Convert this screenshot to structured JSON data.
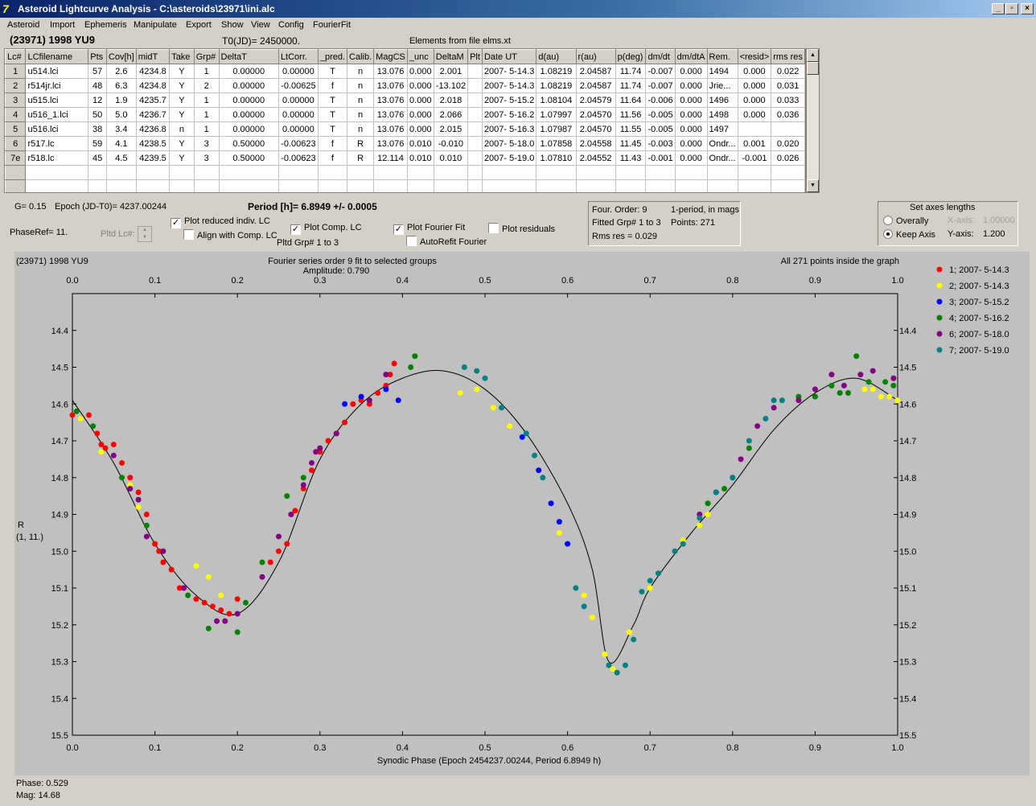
{
  "window": {
    "title": "Asteroid Lightcurve Analysis - C:\\asteroids\\23971\\ini.alc"
  },
  "menu": [
    "Asteroid",
    "Import",
    "Ephemeris",
    "Manipulate",
    "Export",
    "Show",
    "View",
    "Config",
    "FourierFit"
  ],
  "header": {
    "asteroid": "(23971) 1998 YU9",
    "t0": "T0(JD)= 2450000.",
    "elements": "Elements from file elms.xt"
  },
  "table": {
    "columns": [
      "Lc#",
      "LCfilename",
      "Pts",
      "Cov[h]",
      "midT",
      "Take",
      "Grp#",
      "DeltaT",
      "LtCorr.",
      "_pred.",
      "Calib.",
      "MagCS",
      "_unc",
      "DeltaM",
      "Plt",
      "Date UT",
      "d(au)",
      "r(au)",
      "p(deg)",
      "dm/dt",
      "dm/dtA",
      "Rem.",
      "<resid>",
      "rms res"
    ],
    "rows": [
      [
        "1",
        "u514.lci",
        "57",
        "2.6",
        "4234.8",
        "Y",
        "1",
        "0.00000",
        "0.00000",
        "T",
        "n",
        "13.076",
        "0.000",
        "2.001",
        "",
        "2007- 5-14.3",
        "1.08219",
        "2.04587",
        "11.74",
        "-0.007",
        "0.000",
        "1494",
        "0.000",
        "0.022"
      ],
      [
        "2",
        "r514jr.lci",
        "48",
        "6.3",
        "4234.8",
        "Y",
        "2",
        "0.00000",
        "-0.00625",
        "f",
        "n",
        "13.076",
        "0.000",
        "-13.102",
        "",
        "2007- 5-14.3",
        "1.08219",
        "2.04587",
        "11.74",
        "-0.007",
        "0.000",
        "Jrie...",
        "0.000",
        "0.031"
      ],
      [
        "3",
        "u515.lci",
        "12",
        "1.9",
        "4235.7",
        "Y",
        "1",
        "0.00000",
        "0.00000",
        "T",
        "n",
        "13.076",
        "0.000",
        "2.018",
        "",
        "2007- 5-15.2",
        "1.08104",
        "2.04579",
        "11.64",
        "-0.006",
        "0.000",
        "1496",
        "0.000",
        "0.033"
      ],
      [
        "4",
        "u516_1.lci",
        "50",
        "5.0",
        "4236.7",
        "Y",
        "1",
        "0.00000",
        "0.00000",
        "T",
        "n",
        "13.076",
        "0.000",
        "2.066",
        "",
        "2007- 5-16.2",
        "1.07997",
        "2.04570",
        "11.56",
        "-0.005",
        "0.000",
        "1498",
        "0.000",
        "0.036"
      ],
      [
        "5",
        "u516.lci",
        "38",
        "3.4",
        "4236.8",
        "n",
        "1",
        "0.00000",
        "0.00000",
        "T",
        "n",
        "13.076",
        "0.000",
        "2.015",
        "",
        "2007- 5-16.3",
        "1.07987",
        "2.04570",
        "11.55",
        "-0.005",
        "0.000",
        "1497",
        "",
        ""
      ],
      [
        "6",
        "r517.lc",
        "59",
        "4.1",
        "4238.5",
        "Y",
        "3",
        "0.50000",
        "-0.00623",
        "f",
        "R",
        "13.076",
        "0.010",
        "-0.010",
        "",
        "2007- 5-18.0",
        "1.07858",
        "2.04558",
        "11.45",
        "-0.003",
        "0.000",
        "Ondr...",
        "0.001",
        "0.020"
      ],
      [
        "7e",
        "r518.lc",
        "45",
        "4.5",
        "4239.5",
        "Y",
        "3",
        "0.50000",
        "-0.00623",
        "f",
        "R",
        "12.114",
        "0.010",
        "0.010",
        "",
        "2007- 5-19.0",
        "1.07810",
        "2.04552",
        "11.43",
        "-0.001",
        "0.000",
        "Ondr...",
        "-0.001",
        "0.026"
      ]
    ]
  },
  "info": {
    "g": "G= 0.15",
    "epoch": "Epoch (JD-T0)= 4237.00244",
    "period": "Period [h]= 6.8949 +/- 0.0005",
    "phaseref": "PhaseRef= 11.",
    "pltd_lc": "Pltd Lc#:",
    "pltd_grp": "Pltd Grp#  1   to   3"
  },
  "checks": {
    "plot_reduced": "Plot reduced indiv. LC",
    "align_comp": "Align with Comp. LC",
    "plot_comp": "Plot Comp. LC",
    "plot_fourier": "Plot Fourier Fit",
    "autorefit": "AutoRefit Fourier",
    "plot_resid": "Plot residuals"
  },
  "fourier": {
    "order": "Four. Order:  9",
    "period_mode": "1-period, in mags",
    "fitted": "Fitted Grp# 1 to 3",
    "points": "Points: 271",
    "rms": "Rms res     = 0.029"
  },
  "axes": {
    "title": "Set axes lengths",
    "overally": "Overally",
    "keep": "Keep Axis",
    "xlabel": "X-axis:",
    "xval": "1.00000",
    "ylabel": "Y-axis:",
    "yval": "1.200"
  },
  "status": {
    "phase": "Phase:  0.529",
    "mag": "Mag:    14.68"
  },
  "chart_data": {
    "type": "scatter",
    "title_left": "(23971) 1998 YU9",
    "title_center": "Fourier series order 9 fit to selected groups",
    "amplitude": "Amplitude: 0.790",
    "title_right": "All 271 points inside the graph",
    "xlabel": "Synodic Phase (Epoch 2454237.00244, Period 6.8949 h)",
    "ylabel": [
      "R",
      "(1, 11.)"
    ],
    "xlim": [
      0.0,
      1.0
    ],
    "ylim": [
      14.3,
      15.5
    ],
    "y_reversed": true,
    "xticks": [
      "0.0",
      "0.1",
      "0.2",
      "0.3",
      "0.4",
      "0.5",
      "0.6",
      "0.7",
      "0.8",
      "0.9",
      "1.0"
    ],
    "yticks": [
      "14.4",
      "14.5",
      "14.6",
      "14.7",
      "14.8",
      "14.9",
      "15.0",
      "15.1",
      "15.2",
      "15.3",
      "15.4",
      "15.5"
    ],
    "background": "#c0c0c0",
    "legend_position": "right",
    "fit_curve": [
      [
        0,
        14.59
      ],
      [
        0.05,
        14.76
      ],
      [
        0.1,
        14.98
      ],
      [
        0.15,
        15.12
      ],
      [
        0.2,
        15.17
      ],
      [
        0.25,
        15.03
      ],
      [
        0.3,
        14.75
      ],
      [
        0.35,
        14.6
      ],
      [
        0.4,
        14.53
      ],
      [
        0.45,
        14.51
      ],
      [
        0.5,
        14.56
      ],
      [
        0.55,
        14.68
      ],
      [
        0.6,
        14.87
      ],
      [
        0.63,
        15.05
      ],
      [
        0.65,
        15.3
      ],
      [
        0.68,
        15.2
      ],
      [
        0.7,
        15.1
      ],
      [
        0.75,
        14.95
      ],
      [
        0.8,
        14.82
      ],
      [
        0.85,
        14.67
      ],
      [
        0.9,
        14.57
      ],
      [
        0.95,
        14.53
      ],
      [
        1.0,
        14.59
      ]
    ],
    "series": [
      {
        "name": "1; 2007- 5-14.3",
        "color": "#ff0000",
        "points": [
          [
            0.0,
            14.63
          ],
          [
            0.02,
            14.63
          ],
          [
            0.03,
            14.68
          ],
          [
            0.035,
            14.71
          ],
          [
            0.04,
            14.72
          ],
          [
            0.05,
            14.71
          ],
          [
            0.06,
            14.76
          ],
          [
            0.07,
            14.8
          ],
          [
            0.08,
            14.84
          ],
          [
            0.09,
            14.9
          ],
          [
            0.1,
            14.98
          ],
          [
            0.105,
            15.0
          ],
          [
            0.11,
            15.03
          ],
          [
            0.12,
            15.05
          ],
          [
            0.13,
            15.1
          ],
          [
            0.15,
            15.13
          ],
          [
            0.16,
            15.14
          ],
          [
            0.17,
            15.15
          ],
          [
            0.18,
            15.16
          ],
          [
            0.19,
            15.17
          ],
          [
            0.2,
            15.13
          ],
          [
            0.24,
            15.03
          ],
          [
            0.25,
            15.0
          ],
          [
            0.26,
            14.98
          ],
          [
            0.27,
            14.89
          ],
          [
            0.28,
            14.83
          ],
          [
            0.29,
            14.78
          ],
          [
            0.3,
            14.73
          ],
          [
            0.31,
            14.7
          ],
          [
            0.32,
            14.68
          ],
          [
            0.33,
            14.65
          ],
          [
            0.34,
            14.6
          ],
          [
            0.35,
            14.59
          ],
          [
            0.36,
            14.6
          ],
          [
            0.37,
            14.57
          ],
          [
            0.38,
            14.55
          ],
          [
            0.385,
            14.52
          ],
          [
            0.39,
            14.49
          ]
        ]
      },
      {
        "name": "2; 2007- 5-14.3",
        "color": "#ffff00",
        "points": [
          [
            0.01,
            14.64
          ],
          [
            0.035,
            14.73
          ],
          [
            0.07,
            14.82
          ],
          [
            0.08,
            14.88
          ],
          [
            0.15,
            15.04
          ],
          [
            0.165,
            15.07
          ],
          [
            0.18,
            15.12
          ],
          [
            0.47,
            14.57
          ],
          [
            0.49,
            14.56
          ],
          [
            0.51,
            14.61
          ],
          [
            0.53,
            14.66
          ],
          [
            0.59,
            14.95
          ],
          [
            0.62,
            15.12
          ],
          [
            0.63,
            15.18
          ],
          [
            0.645,
            15.28
          ],
          [
            0.655,
            15.32
          ],
          [
            0.675,
            15.22
          ],
          [
            0.7,
            15.1
          ],
          [
            0.74,
            14.97
          ],
          [
            0.76,
            14.93
          ],
          [
            0.77,
            14.9
          ],
          [
            0.96,
            14.56
          ],
          [
            0.97,
            14.56
          ],
          [
            0.98,
            14.58
          ],
          [
            0.99,
            14.58
          ],
          [
            1.0,
            14.59
          ]
        ]
      },
      {
        "name": "3; 2007- 5-15.2",
        "color": "#0000ff",
        "points": [
          [
            0.33,
            14.6
          ],
          [
            0.35,
            14.58
          ],
          [
            0.38,
            14.56
          ],
          [
            0.395,
            14.59
          ],
          [
            0.545,
            14.69
          ],
          [
            0.565,
            14.78
          ],
          [
            0.58,
            14.87
          ],
          [
            0.59,
            14.92
          ],
          [
            0.6,
            14.98
          ]
        ]
      },
      {
        "name": "4; 2007- 5-16.2",
        "color": "#008000",
        "points": [
          [
            0.005,
            14.62
          ],
          [
            0.025,
            14.66
          ],
          [
            0.06,
            14.8
          ],
          [
            0.09,
            14.93
          ],
          [
            0.14,
            15.12
          ],
          [
            0.165,
            15.21
          ],
          [
            0.2,
            15.22
          ],
          [
            0.21,
            15.14
          ],
          [
            0.23,
            15.03
          ],
          [
            0.26,
            14.85
          ],
          [
            0.28,
            14.8
          ],
          [
            0.41,
            14.5
          ],
          [
            0.415,
            14.47
          ],
          [
            0.77,
            14.87
          ],
          [
            0.79,
            14.83
          ],
          [
            0.82,
            14.72
          ],
          [
            0.88,
            14.58
          ],
          [
            0.9,
            14.58
          ],
          [
            0.92,
            14.55
          ],
          [
            0.93,
            14.57
          ],
          [
            0.94,
            14.57
          ],
          [
            0.95,
            14.47
          ],
          [
            0.965,
            14.54
          ],
          [
            0.985,
            14.54
          ],
          [
            0.995,
            14.55
          ]
        ]
      },
      {
        "name": "6; 2007- 5-18.0",
        "color": "#800080",
        "points": [
          [
            0.05,
            14.74
          ],
          [
            0.07,
            14.83
          ],
          [
            0.08,
            14.86
          ],
          [
            0.09,
            14.96
          ],
          [
            0.11,
            15.0
          ],
          [
            0.135,
            15.1
          ],
          [
            0.175,
            15.19
          ],
          [
            0.185,
            15.19
          ],
          [
            0.2,
            15.17
          ],
          [
            0.23,
            15.07
          ],
          [
            0.25,
            14.96
          ],
          [
            0.265,
            14.9
          ],
          [
            0.28,
            14.82
          ],
          [
            0.29,
            14.76
          ],
          [
            0.295,
            14.73
          ],
          [
            0.3,
            14.72
          ],
          [
            0.32,
            14.68
          ],
          [
            0.36,
            14.59
          ],
          [
            0.38,
            14.52
          ],
          [
            0.76,
            14.9
          ],
          [
            0.78,
            14.84
          ],
          [
            0.8,
            14.8
          ],
          [
            0.81,
            14.75
          ],
          [
            0.83,
            14.66
          ],
          [
            0.85,
            14.61
          ],
          [
            0.88,
            14.59
          ],
          [
            0.9,
            14.56
          ],
          [
            0.92,
            14.52
          ],
          [
            0.935,
            14.55
          ],
          [
            0.955,
            14.52
          ],
          [
            0.97,
            14.51
          ],
          [
            0.995,
            14.53
          ]
        ]
      },
      {
        "name": "7; 2007- 5-19.0",
        "color": "#008080",
        "points": [
          [
            0.475,
            14.5
          ],
          [
            0.49,
            14.51
          ],
          [
            0.5,
            14.53
          ],
          [
            0.52,
            14.61
          ],
          [
            0.55,
            14.68
          ],
          [
            0.56,
            14.74
          ],
          [
            0.57,
            14.8
          ],
          [
            0.61,
            15.1
          ],
          [
            0.62,
            15.15
          ],
          [
            0.65,
            15.31
          ],
          [
            0.66,
            15.33
          ],
          [
            0.67,
            15.31
          ],
          [
            0.68,
            15.24
          ],
          [
            0.69,
            15.11
          ],
          [
            0.7,
            15.08
          ],
          [
            0.71,
            15.06
          ],
          [
            0.73,
            15.0
          ],
          [
            0.74,
            14.98
          ],
          [
            0.76,
            14.91
          ],
          [
            0.78,
            14.84
          ],
          [
            0.8,
            14.8
          ],
          [
            0.82,
            14.7
          ],
          [
            0.84,
            14.64
          ],
          [
            0.85,
            14.59
          ],
          [
            0.86,
            14.59
          ]
        ]
      }
    ]
  }
}
